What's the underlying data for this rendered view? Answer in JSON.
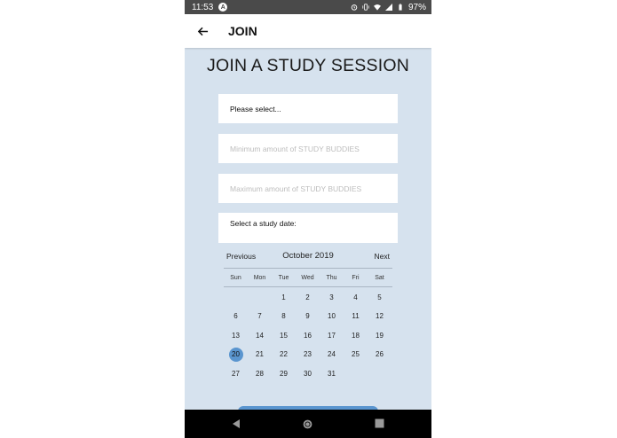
{
  "status_bar": {
    "time": "11:53",
    "battery": "97%"
  },
  "app_bar": {
    "title": "JOIN"
  },
  "page": {
    "heading": "JOIN A STUDY SESSION",
    "select_placeholder": "Please select...",
    "min_placeholder": "Minimum amount of STUDY BUDDIES",
    "max_placeholder": "Maximum amount of STUDY BUDDIES",
    "date_label": "Select a study date:"
  },
  "calendar": {
    "prev_label": "Previous",
    "next_label": "Next",
    "month": "October 2019",
    "weekdays": [
      "Sun",
      "Mon",
      "Tue",
      "Wed",
      "Thu",
      "Fri",
      "Sat"
    ],
    "first_weekday_index": 2,
    "days": [
      "1",
      "2",
      "3",
      "4",
      "5",
      "6",
      "7",
      "8",
      "9",
      "10",
      "11",
      "12",
      "13",
      "14",
      "15",
      "16",
      "17",
      "18",
      "19",
      "20",
      "21",
      "22",
      "23",
      "24",
      "25",
      "26",
      "27",
      "28",
      "29",
      "30",
      "31"
    ],
    "selected_day": "20",
    "selected_color": "#5a95cf"
  },
  "colors": {
    "background": "#d6e2ee",
    "status_bar": "#4a4a4a",
    "accent": "#5a95cf"
  }
}
